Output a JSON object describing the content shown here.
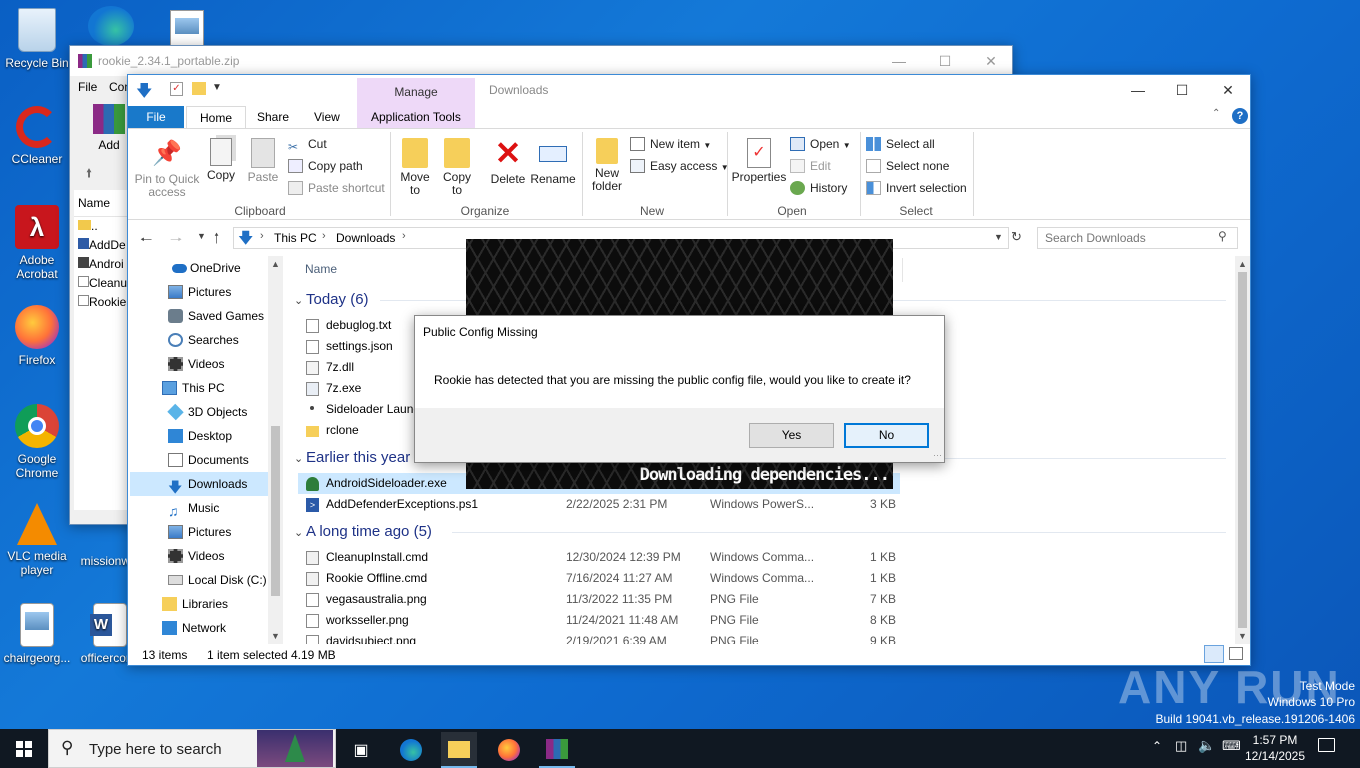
{
  "desktop": {
    "icons": [
      {
        "label": "Recycle Bin"
      },
      {
        "label": "CCleaner"
      },
      {
        "label": "Adobe Acrobat"
      },
      {
        "label": "Firefox"
      },
      {
        "label": "Google Chrome"
      },
      {
        "label": "VLC media player"
      },
      {
        "label": "chairgeorg..."
      },
      {
        "label": "missionw..."
      },
      {
        "label": "officercor..."
      }
    ],
    "watermark": {
      "brand": "ANY RUN",
      "mode": "Test Mode",
      "os": "Windows 10 Pro",
      "build": "Build 19041.vb_release.191206-1406"
    }
  },
  "winrar": {
    "title": "rookie_2.34.1_portable.zip",
    "menu": [
      "File",
      "Com"
    ],
    "add_label": "Add",
    "col_name": "Name",
    "items": [
      "..",
      "AddDe",
      "Androi",
      "Cleanu",
      "Rookie"
    ]
  },
  "explorer": {
    "title": "Downloads",
    "contextual_tab": "Manage",
    "tabs": [
      "File",
      "Home",
      "Share",
      "View",
      "Application Tools"
    ],
    "ribbon": {
      "clipboard": {
        "pin": "Pin to Quick access",
        "copy": "Copy",
        "paste": "Paste",
        "cut": "Cut",
        "copy_path": "Copy path",
        "paste_shortcut": "Paste shortcut",
        "group": "Clipboard"
      },
      "organize": {
        "move_to": "Move to",
        "copy_to": "Copy to",
        "delete": "Delete",
        "rename": "Rename",
        "group": "Organize"
      },
      "new": {
        "new_folder": "New folder",
        "new_item": "New item",
        "easy_access": "Easy access",
        "group": "New"
      },
      "open": {
        "properties": "Properties",
        "open": "Open",
        "edit": "Edit",
        "history": "History",
        "group": "Open"
      },
      "select": {
        "select_all": "Select all",
        "select_none": "Select none",
        "invert": "Invert selection",
        "group": "Select"
      }
    },
    "address": {
      "crumbs": [
        "This PC",
        "Downloads"
      ],
      "search_placeholder": "Search Downloads"
    },
    "nav": [
      "OneDrive",
      "Pictures",
      "Saved Games",
      "Searches",
      "Videos",
      "This PC",
      "3D Objects",
      "Desktop",
      "Documents",
      "Downloads",
      "Music",
      "Pictures",
      "Videos",
      "Local Disk (C:)",
      "Libraries",
      "Network"
    ],
    "column_name": "Name",
    "groups": {
      "today": "Today (6)",
      "earlier": "Earlier this year",
      "long_ago": "A long time ago (5)"
    },
    "today_files": [
      {
        "name": "debuglog.txt"
      },
      {
        "name": "settings.json"
      },
      {
        "name": "7z.dll"
      },
      {
        "name": "7z.exe"
      },
      {
        "name": "Sideloader Launc"
      },
      {
        "name": "rclone"
      }
    ],
    "earlier_files": [
      {
        "name": "AndroidSideloader.exe",
        "date": "",
        "type": "",
        "size": ""
      },
      {
        "name": "AddDefenderExceptions.ps1",
        "date": "2/22/2025 2:31 PM",
        "type": "Windows PowerS...",
        "size": "3 KB"
      }
    ],
    "old_files": [
      {
        "name": "CleanupInstall.cmd",
        "date": "12/30/2024 12:39 PM",
        "type": "Windows Comma...",
        "size": "1 KB"
      },
      {
        "name": "Rookie Offline.cmd",
        "date": "7/16/2024 11:27 AM",
        "type": "Windows Comma...",
        "size": "1 KB"
      },
      {
        "name": "vegasaustralia.png",
        "date": "11/3/2022 11:35 PM",
        "type": "PNG File",
        "size": "7 KB"
      },
      {
        "name": "worksseller.png",
        "date": "11/24/2021 11:48 AM",
        "type": "PNG File",
        "size": "8 KB"
      },
      {
        "name": "davidsubject.png",
        "date": "2/19/2021 6:39 AM",
        "type": "PNG File",
        "size": "9 KB"
      }
    ],
    "status": {
      "count": "13 items",
      "selected": "1 item selected",
      "size": "4.19 MB"
    }
  },
  "splash": {
    "text": "Downloading dependencies..."
  },
  "dialog": {
    "title": "Public Config Missing",
    "message": "Rookie has detected that you are missing the public config file, would you like to create it?",
    "yes": "Yes",
    "no": "No"
  },
  "taskbar": {
    "search_placeholder": "Type here to search",
    "time": "1:57 PM",
    "date": "12/14/2025"
  }
}
